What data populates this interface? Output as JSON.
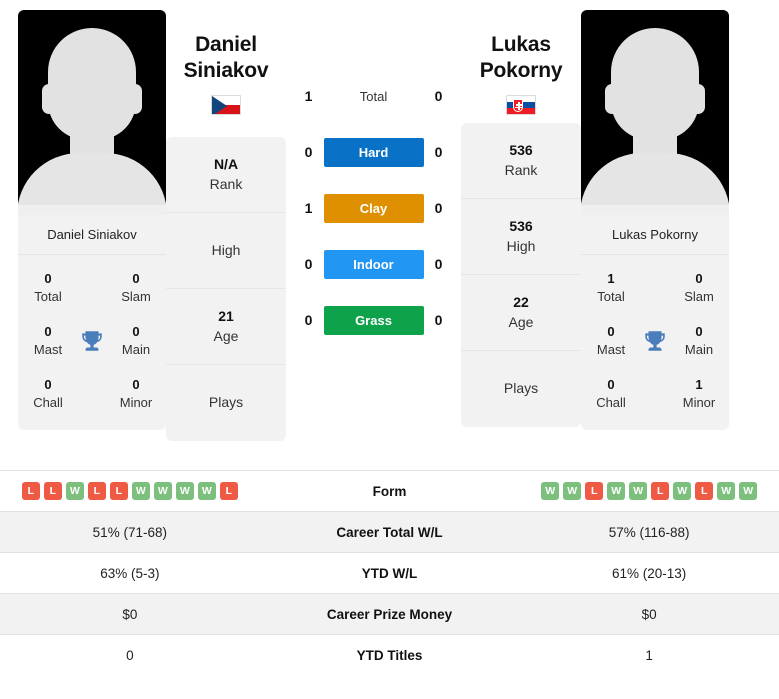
{
  "players": {
    "left": {
      "first_name": "Daniel",
      "last_name": "Siniakov",
      "full_name": "Daniel Siniakov",
      "country": "Czech Republic",
      "flag_icon": "flag-czech-republic",
      "rank": "N/A",
      "rank_label": "Rank",
      "high": "",
      "high_label": "High",
      "age": "21",
      "age_label": "Age",
      "plays": "",
      "plays_label": "Plays",
      "titles": {
        "total": "0",
        "total_label": "Total",
        "slam": "0",
        "slam_label": "Slam",
        "mast": "0",
        "mast_label": "Mast",
        "main": "0",
        "main_label": "Main",
        "chall": "0",
        "chall_label": "Chall",
        "minor": "0",
        "minor_label": "Minor"
      },
      "form": [
        "L",
        "L",
        "W",
        "L",
        "L",
        "W",
        "W",
        "W",
        "W",
        "L"
      ],
      "career_total_wl": "51% (71-68)",
      "ytd_wl": "63% (5-3)",
      "career_prize_money": "$0",
      "ytd_titles": "0"
    },
    "right": {
      "first_name": "Lukas",
      "last_name": "Pokorny",
      "full_name": "Lukas Pokorny",
      "country": "Slovakia",
      "flag_icon": "flag-slovakia",
      "rank": "536",
      "rank_label": "Rank",
      "high": "536",
      "high_label": "High",
      "age": "22",
      "age_label": "Age",
      "plays": "",
      "plays_label": "Plays",
      "titles": {
        "total": "1",
        "total_label": "Total",
        "slam": "0",
        "slam_label": "Slam",
        "mast": "0",
        "mast_label": "Mast",
        "main": "0",
        "main_label": "Main",
        "chall": "0",
        "chall_label": "Chall",
        "minor": "1",
        "minor_label": "Minor"
      },
      "form": [
        "W",
        "W",
        "L",
        "W",
        "W",
        "L",
        "W",
        "L",
        "W",
        "W"
      ],
      "career_total_wl": "57% (116-88)",
      "ytd_wl": "61% (20-13)",
      "career_prize_money": "$0",
      "ytd_titles": "1"
    }
  },
  "head_to_head": [
    {
      "label": "Total",
      "left": "1",
      "right": "0",
      "color": "",
      "style": "plain"
    },
    {
      "label": "Hard",
      "left": "0",
      "right": "0",
      "color": "#0a72c6",
      "style": "badge"
    },
    {
      "label": "Clay",
      "left": "1",
      "right": "0",
      "color": "#de9000",
      "style": "badge"
    },
    {
      "label": "Indoor",
      "left": "0",
      "right": "0",
      "color": "#2196f3",
      "style": "badge"
    },
    {
      "label": "Grass",
      "left": "0",
      "right": "0",
      "color": "#0ea24a",
      "style": "badge"
    }
  ],
  "stats_rows": [
    {
      "label": "Form",
      "type": "form"
    },
    {
      "label": "Career Total W/L",
      "type": "text",
      "left": "51% (71-68)",
      "right": "57% (116-88)"
    },
    {
      "label": "YTD W/L",
      "type": "text",
      "left": "63% (5-3)",
      "right": "61% (20-13)"
    },
    {
      "label": "Career Prize Money",
      "type": "text",
      "left": "$0",
      "right": "$0"
    },
    {
      "label": "YTD Titles",
      "type": "text",
      "left": "0",
      "right": "1"
    }
  ],
  "colors": {
    "hard": "#0a72c6",
    "clay": "#de9000",
    "indoor": "#2196f3",
    "grass": "#0ea24a",
    "win": "#7dc07d",
    "loss": "#ef5a45",
    "trophy": "#4a7ebb",
    "panel": "#f2f2f2"
  },
  "icons": {
    "trophy": "trophy-icon",
    "avatar": "player-avatar-placeholder"
  }
}
